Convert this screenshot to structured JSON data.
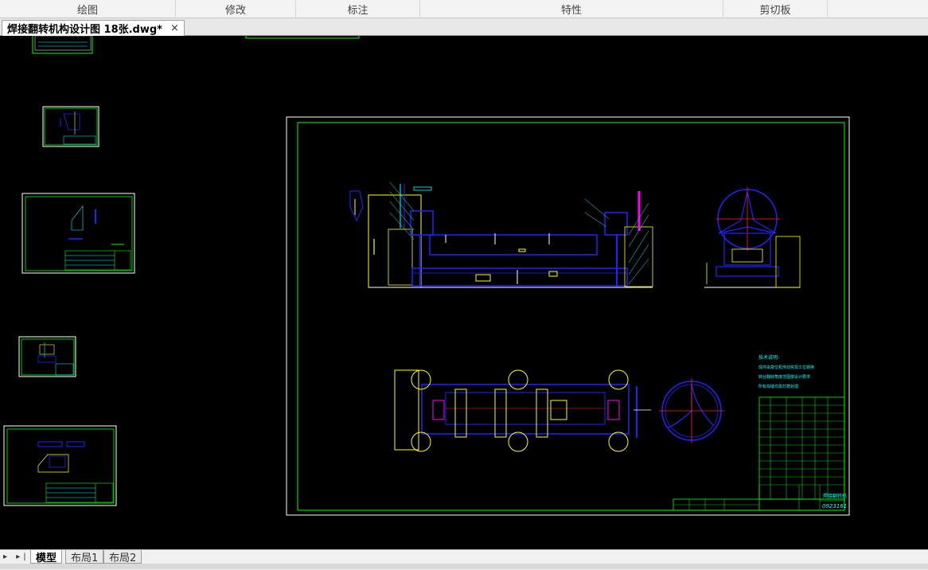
{
  "ribbon": {
    "groups": [
      "绘图",
      "修改",
      "标注",
      "特性",
      "剪切板"
    ]
  },
  "document": {
    "tab_title": "焊接翻转机构设计图 18张.dwg*",
    "close_symbol": "×"
  },
  "layout_tabs": [
    "模型",
    "布局1",
    "布局2"
  ],
  "nav_arrows": "▸ ▸|",
  "drawing": {
    "tech_notes_title": "技术说明:",
    "tech_notes": [
      "焊件由变位机传动实现工位转换",
      "转台翻转角度范围按设计要求",
      "所有焊缝均需打磨处理"
    ],
    "title_block_name": "焊接翻转机",
    "title_block_code": "0923161"
  },
  "colors": {
    "background": "#000000",
    "frame_green": "#00ff00",
    "line_blue": "#2222ff",
    "line_yellow": "#ffff00",
    "line_cyan": "#00ffff",
    "line_magenta": "#ff00ff",
    "line_white": "#ffffff",
    "line_red": "#ff2222"
  }
}
